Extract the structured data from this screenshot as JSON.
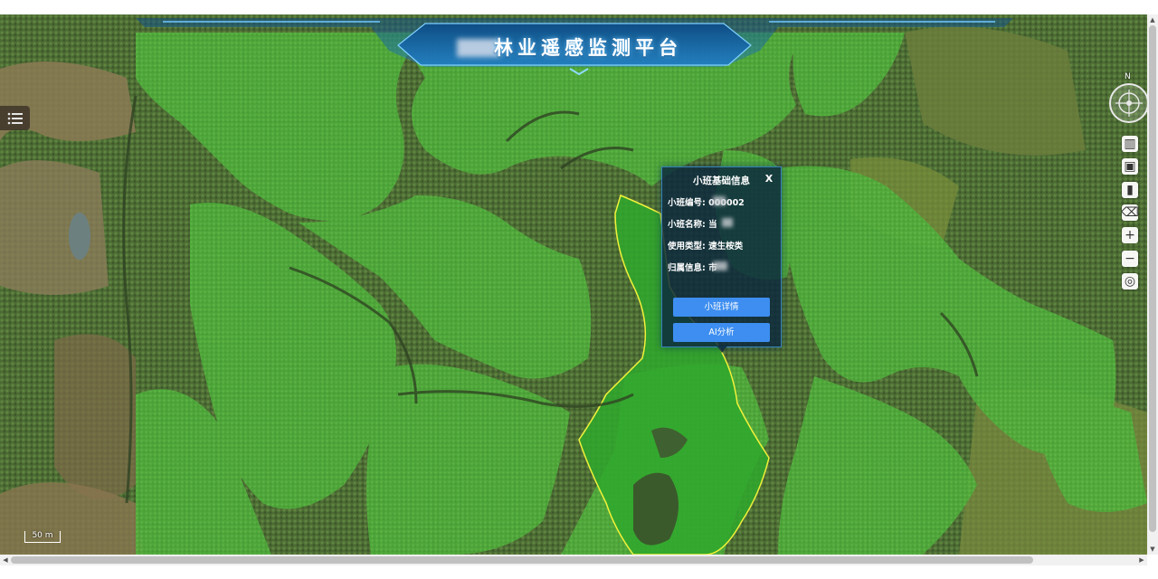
{
  "header": {
    "title_masked": "▓▓",
    "title": "林业遥感监测平台"
  },
  "map": {
    "compass_label": "N",
    "scale_label": "50 m"
  },
  "toolbar": {
    "items": [
      {
        "name": "ruler-icon",
        "glyph": "▥"
      },
      {
        "name": "area-measure-icon",
        "glyph": "▣"
      },
      {
        "name": "height-measure-icon",
        "glyph": "▮"
      },
      {
        "name": "eraser-icon",
        "glyph": "⌫"
      },
      {
        "name": "zoom-in-icon",
        "glyph": "+"
      },
      {
        "name": "zoom-out-icon",
        "glyph": "−"
      },
      {
        "name": "locate-icon",
        "glyph": "◎"
      }
    ]
  },
  "popup": {
    "title": "小班基础信息",
    "close": "X",
    "fields": [
      {
        "label": "小班编号:",
        "value": "000002"
      },
      {
        "label": "小班名称:",
        "value": "当"
      },
      {
        "label": "使用类型:",
        "value": "速生桉类"
      },
      {
        "label": "归属信息:",
        "value": "市"
      }
    ],
    "detail_button": "小班详情",
    "ai_button": "AI分析"
  },
  "colors": {
    "parcel_fill": "#3aa83a",
    "selected_outline": "#f1f23a",
    "popup_bg": "#0c283e",
    "button_blue": "#3d8ef0"
  }
}
